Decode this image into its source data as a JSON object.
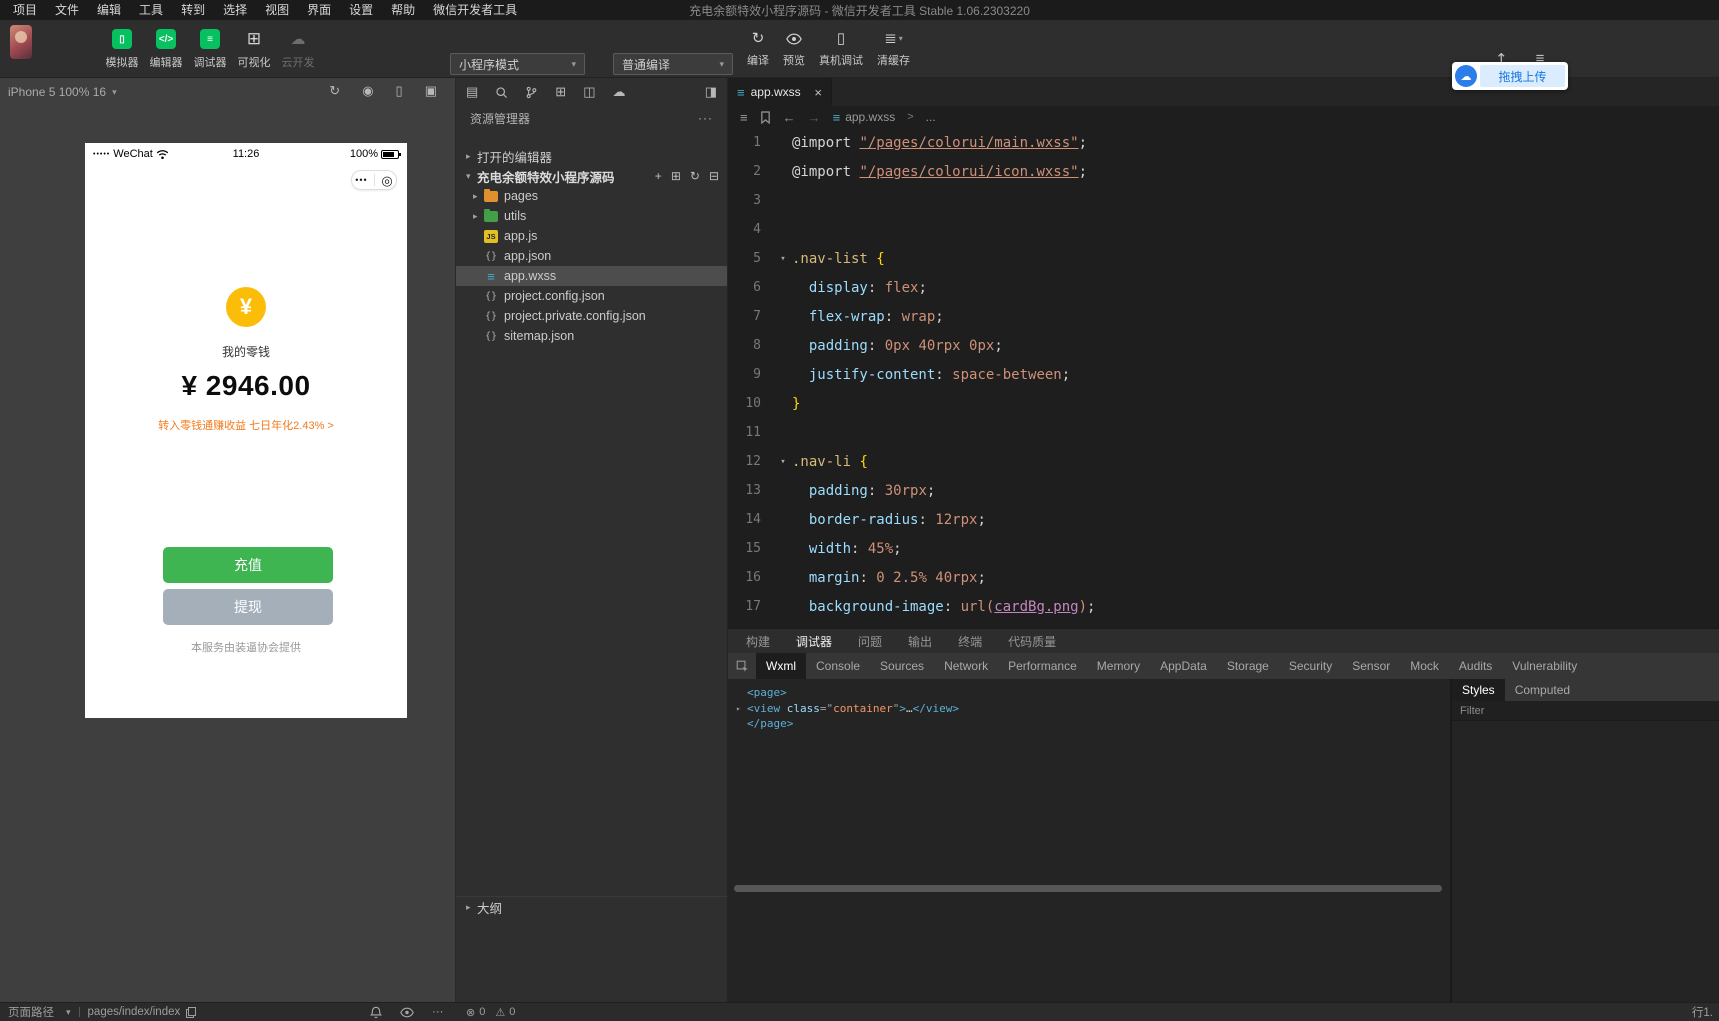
{
  "menu_bar": {
    "items": [
      "项目",
      "文件",
      "编辑",
      "工具",
      "转到",
      "选择",
      "视图",
      "界面",
      "设置",
      "帮助",
      "微信开发者工具"
    ],
    "title": "充电余额特效小程序源码 - 微信开发者工具 Stable 1.06.2303220"
  },
  "toolbar": {
    "buttons": [
      {
        "label": "模拟器",
        "name": "simulator",
        "state": "on"
      },
      {
        "label": "编辑器",
        "name": "editor",
        "state": "on"
      },
      {
        "label": "调试器",
        "name": "debugger",
        "state": "on"
      },
      {
        "label": "可视化",
        "name": "visualization",
        "state": "off"
      },
      {
        "label": "云开发",
        "name": "cloud-dev",
        "state": "disabled"
      }
    ],
    "mode_select": "小程序模式",
    "compile_select": "普通编译",
    "actions": [
      {
        "label": "编译",
        "name": "compile"
      },
      {
        "label": "预览",
        "name": "preview"
      },
      {
        "label": "真机调试",
        "name": "device-debug"
      },
      {
        "label": "清缓存",
        "name": "clear-cache"
      }
    ],
    "drag_upload_label": "拖拽上传"
  },
  "simulator": {
    "device_label": "iPhone 5 100% 16",
    "status_bar": {
      "signal_dots": "•••••",
      "carrier": "WeChat",
      "time": "11:26",
      "battery": "100%"
    },
    "capsule_dots": "•••",
    "coin_symbol": "¥",
    "wallet_label": "我的零钱",
    "balance": "¥ 2946.00",
    "promo": "转入零钱通赚收益 七日年化2.43% >",
    "recharge": "充值",
    "withdraw": "提现",
    "footer": "本服务由装逼协会提供"
  },
  "explorer": {
    "title": "资源管理器",
    "open_editors": "打开的编辑器",
    "project_name": "充电余额特效小程序源码",
    "files": [
      {
        "name": "pages",
        "kind": "folder",
        "color": "#e0912f"
      },
      {
        "name": "utils",
        "kind": "folder",
        "color": "#43a047"
      },
      {
        "name": "app.js",
        "kind": "js"
      },
      {
        "name": "app.json",
        "kind": "json"
      },
      {
        "name": "app.wxss",
        "kind": "wxss",
        "selected": true
      },
      {
        "name": "project.config.json",
        "kind": "json"
      },
      {
        "name": "project.private.config.json",
        "kind": "json"
      },
      {
        "name": "sitemap.json",
        "kind": "json"
      }
    ],
    "outline": "大纲"
  },
  "editor": {
    "tab": "app.wxss",
    "breadcrumb_file": "app.wxss",
    "breadcrumb_sep": ">",
    "breadcrumb_more": "...",
    "code": [
      {
        "n": 1,
        "t": [
          [
            "d",
            "@import "
          ],
          [
            "s",
            "\"/pages/colorui/main.wxss\""
          ],
          [
            "d",
            ";"
          ]
        ]
      },
      {
        "n": 2,
        "t": [
          [
            "d",
            "@import "
          ],
          [
            "s",
            "\"/pages/colorui/icon.wxss\""
          ],
          [
            "d",
            ";"
          ]
        ]
      },
      {
        "n": 3,
        "t": []
      },
      {
        "n": 4,
        "t": []
      },
      {
        "n": 5,
        "fold": true,
        "t": [
          [
            "sel",
            ".nav-list"
          ],
          [
            "d",
            " "
          ],
          [
            "br",
            "{"
          ]
        ]
      },
      {
        "n": 6,
        "t": [
          [
            "d",
            "  "
          ],
          [
            "p",
            "display"
          ],
          [
            "d",
            ": "
          ],
          [
            "v",
            "flex"
          ],
          [
            "d",
            ";"
          ]
        ]
      },
      {
        "n": 7,
        "t": [
          [
            "d",
            "  "
          ],
          [
            "p",
            "flex-wrap"
          ],
          [
            "d",
            ": "
          ],
          [
            "v",
            "wrap"
          ],
          [
            "d",
            ";"
          ]
        ]
      },
      {
        "n": 8,
        "t": [
          [
            "d",
            "  "
          ],
          [
            "p",
            "padding"
          ],
          [
            "d",
            ": "
          ],
          [
            "v",
            "0px 40rpx 0px"
          ],
          [
            "d",
            ";"
          ]
        ]
      },
      {
        "n": 9,
        "t": [
          [
            "d",
            "  "
          ],
          [
            "p",
            "justify-content"
          ],
          [
            "d",
            ": "
          ],
          [
            "v",
            "space-between"
          ],
          [
            "d",
            ";"
          ]
        ]
      },
      {
        "n": 10,
        "t": [
          [
            "br",
            "}"
          ]
        ]
      },
      {
        "n": 11,
        "t": []
      },
      {
        "n": 12,
        "fold": true,
        "t": [
          [
            "sel",
            ".nav-li"
          ],
          [
            "d",
            " "
          ],
          [
            "br",
            "{"
          ]
        ]
      },
      {
        "n": 13,
        "t": [
          [
            "d",
            "  "
          ],
          [
            "p",
            "padding"
          ],
          [
            "d",
            ": "
          ],
          [
            "v",
            "30rpx"
          ],
          [
            "d",
            ";"
          ]
        ]
      },
      {
        "n": 14,
        "t": [
          [
            "d",
            "  "
          ],
          [
            "p",
            "border-radius"
          ],
          [
            "d",
            ": "
          ],
          [
            "v",
            "12rpx"
          ],
          [
            "d",
            ";"
          ]
        ]
      },
      {
        "n": 15,
        "t": [
          [
            "d",
            "  "
          ],
          [
            "p",
            "width"
          ],
          [
            "d",
            ": "
          ],
          [
            "v",
            "45%"
          ],
          [
            "d",
            ";"
          ]
        ]
      },
      {
        "n": 16,
        "t": [
          [
            "d",
            "  "
          ],
          [
            "p",
            "margin"
          ],
          [
            "d",
            ": "
          ],
          [
            "v",
            "0 2.5% 40rpx"
          ],
          [
            "d",
            ";"
          ]
        ]
      },
      {
        "n": 17,
        "t": [
          [
            "d",
            "  "
          ],
          [
            "p",
            "background-image"
          ],
          [
            "d",
            ": "
          ],
          [
            "v",
            "url("
          ],
          [
            "lk",
            "cardBg.png"
          ],
          [
            "v",
            ")"
          ],
          [
            "d",
            ";"
          ]
        ]
      }
    ]
  },
  "bottom": {
    "panel_tabs": [
      "构建",
      "调试器",
      "问题",
      "输出",
      "终端",
      "代码质量"
    ],
    "active_panel_tab": "调试器",
    "devtools_tabs": [
      "Wxml",
      "Console",
      "Sources",
      "Network",
      "Performance",
      "Memory",
      "AppData",
      "Storage",
      "Security",
      "Sensor",
      "Mock",
      "Audits",
      "Vulnerability"
    ],
    "active_devtools_tab": "Wxml",
    "wxml": [
      {
        "expand": false,
        "t": [
          [
            "tag",
            "<page>"
          ]
        ]
      },
      {
        "expand": true,
        "t": [
          [
            "tag",
            "<view"
          ],
          [
            "d",
            " "
          ],
          [
            "attr",
            "class"
          ],
          [
            "p",
            "=\""
          ],
          [
            "val",
            "container"
          ],
          [
            "p",
            "\""
          ],
          [
            "tag",
            ">"
          ],
          [
            "d",
            "…"
          ],
          [
            "tag",
            "</view>"
          ]
        ]
      },
      {
        "expand": false,
        "t": [
          [
            "tag",
            "</page>"
          ]
        ]
      }
    ],
    "styles_tabs": [
      "Styles",
      "Computed"
    ],
    "active_styles_tab": "Styles",
    "filter_label": "Filter"
  },
  "status_bar": {
    "path_label": "页面路径",
    "path_value": "pages/index/index",
    "error_count": "0",
    "warning_count": "0",
    "cursor_info": "行1."
  },
  "icons": {
    "chevron_down": "▾",
    "chevron_right": "▸",
    "ellipsis": "···",
    "plus": "+",
    "new_folder": "⊞",
    "refresh": "↻",
    "collapse": "⊟",
    "files": "▤",
    "grid": "⊞",
    "split": "◫",
    "cloud": "☁",
    "panel_toggle": "◨",
    "rotate": "↻",
    "record": "◉",
    "device": "▯",
    "windows": "▣",
    "close": "×",
    "back": "←",
    "forward": "→",
    "list": "≡",
    "wxss": "≡",
    "layers": "≣",
    "upload": "↥",
    "menu": "≡",
    "target": "◎",
    "error": "⊗",
    "warning": "⚠"
  },
  "colors": {
    "accent_green": "#07c160",
    "button_green": "#3eb551",
    "button_gray": "#a5afb9",
    "coin_yellow": "#fbbd08",
    "promo_orange": "#f37b1d",
    "link_blue": "#1777e0"
  }
}
